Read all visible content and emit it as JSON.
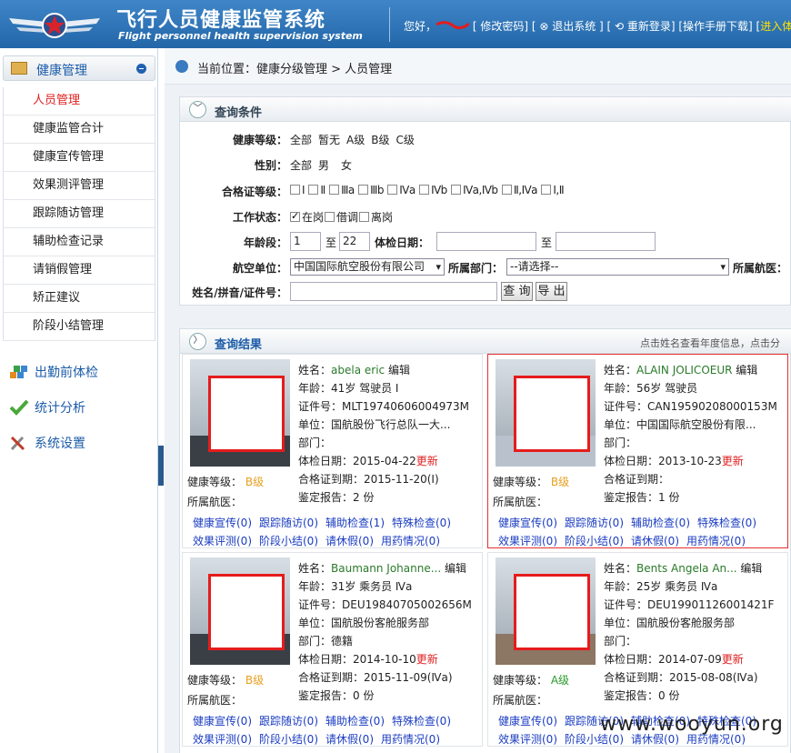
{
  "header": {
    "title_cn": "飞行人员健康监管系统",
    "title_en": "Flight personnel health supervision system",
    "greeting": "您好，",
    "user_name": "",
    "links": "[ 修改密码] [ ⊗ 退出系统 ] [ ⟲ 重新登录] [操作手册下载] [",
    "enter": "进入体"
  },
  "sidebar": {
    "section": "健康管理",
    "items": [
      "人员管理",
      "健康监管合计",
      "健康宣传管理",
      "效果测评管理",
      "跟踪随访管理",
      "辅助检查记录",
      "请销假管理",
      "矫正建议",
      "阶段小结管理"
    ],
    "sections": [
      "出勤前体检",
      "统计分析",
      "系统设置"
    ]
  },
  "breadcrumb": "当前位置：健康分级管理 > 人员管理",
  "query": {
    "title": "查询条件",
    "health_label": "健康等级：",
    "health_opts": [
      "全部",
      "暂无",
      "A级",
      "B级",
      "C级"
    ],
    "gender_label": "性别：",
    "gender_opts": [
      "全部",
      "男",
      "女"
    ],
    "cert_label": "合格证等级：",
    "cert_opts": [
      "Ⅰ",
      "Ⅱ",
      "Ⅲa",
      "Ⅲb",
      "Ⅳa",
      "Ⅳb",
      "Ⅳa,Ⅳb",
      "Ⅱ,Ⅳa",
      "Ⅰ,Ⅱ"
    ],
    "work_label": "工作状态：",
    "work_opts": [
      "在岗",
      "借调",
      "离岗"
    ],
    "age_label": "年龄段：",
    "age_from": "1",
    "to": "至",
    "age_to": "22",
    "exam_label": "体检日期：",
    "exam_to": "至",
    "airline_label": "航空单位：",
    "airline_value": "中国国际航空股份有限公司",
    "dept_label": "所属部门：",
    "dept_value": "--请选择--",
    "doctor_label": "所属航医：",
    "name_label": "姓名/拼音/证件号：",
    "search_btn": "查 询",
    "export_btn": "导 出"
  },
  "results": {
    "title": "查询结果",
    "hint": "点击姓名查看年度信息，点击分",
    "cards": [
      {
        "name": "abela eric",
        "edit": "编辑",
        "age": "年龄：41岁 驾驶员 Ⅰ",
        "id": "证件号：MLT19740606004973M",
        "unit": "单位：国航股份飞行总队一大...",
        "dept": "部门：",
        "exam_date": "体检日期：2015-04-22",
        "exam_new": "更新",
        "valid": "合格证到期：2015-11-20(Ⅰ)",
        "report": "鉴定报告：2 份",
        "level_label": "健康等级：",
        "level": "B级",
        "doctor": "所属航医：",
        "l1": [
          "健康宣传(0)",
          "跟踪随访(0)",
          "辅助检查(1)",
          "特殊检查(0)"
        ],
        "l2": [
          "效果评测(0)",
          "阶段小结(0)",
          "请休假(0)",
          "用药情况(0)"
        ]
      },
      {
        "name": "ALAIN JOLICOEUR",
        "edit": "编辑",
        "age": "年龄：56岁 驾驶员",
        "id": "证件号：CAN19590208000153M",
        "unit": "单位：中国国际航空股份有限...",
        "dept": "部门：",
        "exam_date": "体检日期：2013-10-23",
        "exam_new": "更新",
        "valid": "合格证到期：",
        "report": "鉴定报告：1 份",
        "level_label": "健康等级：",
        "level": "B级",
        "doctor": "所属航医：",
        "l1": [
          "健康宣传(0)",
          "跟踪随访(0)",
          "辅助检查(0)",
          "特殊检查(0)"
        ],
        "l2": [
          "效果评测(0)",
          "阶段小结(0)",
          "请休假(0)",
          "用药情况(0)"
        ]
      },
      {
        "name": "Baumann Johanne...",
        "edit": "编辑",
        "age": "年龄：31岁 乘务员 Ⅳa",
        "id": "证件号：DEU19840705002656M",
        "unit": "单位：国航股份客舱服务部",
        "dept": "部门：德籍",
        "exam_date": "体检日期：2014-10-10",
        "exam_new": "更新",
        "valid": "合格证到期：2015-11-09(Ⅳa)",
        "report": "鉴定报告：0 份",
        "level_label": "健康等级：",
        "level": "B级",
        "doctor": "所属航医：",
        "l1": [
          "健康宣传(0)",
          "跟踪随访(0)",
          "辅助检查(0)",
          "特殊检查(0)"
        ],
        "l2": [
          "效果评测(0)",
          "阶段小结(0)",
          "请休假(0)",
          "用药情况(0)"
        ]
      },
      {
        "name": "Bents Angela An...",
        "edit": "编辑",
        "age": "年龄：25岁 乘务员 Ⅳa",
        "id": "证件号：DEU19901126001421F",
        "unit": "单位：国航股份客舱服务部",
        "dept": "部门：",
        "exam_date": "体检日期：2014-07-09",
        "exam_new": "更新",
        "valid": "合格证到期：2015-08-08(Ⅳa)",
        "report": "鉴定报告：0 份",
        "level_label": "健康等级：",
        "level": "A级",
        "doctor": "所属航医：",
        "l1": [
          "健康宣传(0)",
          "跟踪随访(0)",
          "辅助检查(0)",
          "特殊检查(0)"
        ],
        "l2": [
          "效果评测(0)",
          "阶段小结(0)",
          "请休假(0)",
          "用药情况(0)"
        ]
      }
    ]
  },
  "watermark": "www.wooyun.org"
}
